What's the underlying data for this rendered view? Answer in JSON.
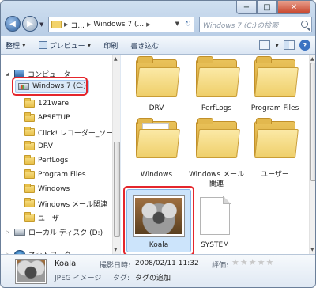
{
  "address": {
    "segments": [
      "コ...",
      "Windows 7 (..."
    ]
  },
  "search": {
    "placeholder": "Windows 7 (C:)の検索"
  },
  "toolbar": {
    "organize": "整理",
    "preview": "プレビュー",
    "print": "印刷",
    "burn": "書き込む"
  },
  "window_controls": {
    "minimize": "−",
    "maximize": "□",
    "close": "✕"
  },
  "nav": {
    "computer": "コンピューター",
    "drive_c": "Windows 7 (C:)",
    "folders": [
      "121ware",
      "APSETUP",
      "Click! レコーダー_ソー",
      "DRV",
      "PerfLogs",
      "Program Files",
      "Windows",
      "Windows メール関連",
      "ユーザー"
    ],
    "drive_d": "ローカル ディスク (D:)",
    "network": "ネットワーク"
  },
  "content": {
    "tiles": [
      "DRV",
      "PerfLogs",
      "Program Files",
      "Windows",
      "Windows メール関連",
      "ユーザー",
      "Koala",
      "SYSTEM"
    ]
  },
  "details": {
    "name": "Koala",
    "type": "JPEG イメージ",
    "date_label": "撮影日時:",
    "date_value": "2008/02/11 11:32",
    "tag_label": "タグ:",
    "tag_value": "タグの追加",
    "rating_label": "評価:",
    "rating": 0,
    "rating_max": 5
  },
  "colors": {
    "highlight": "#e4262c",
    "selection": "#cce4fb"
  }
}
